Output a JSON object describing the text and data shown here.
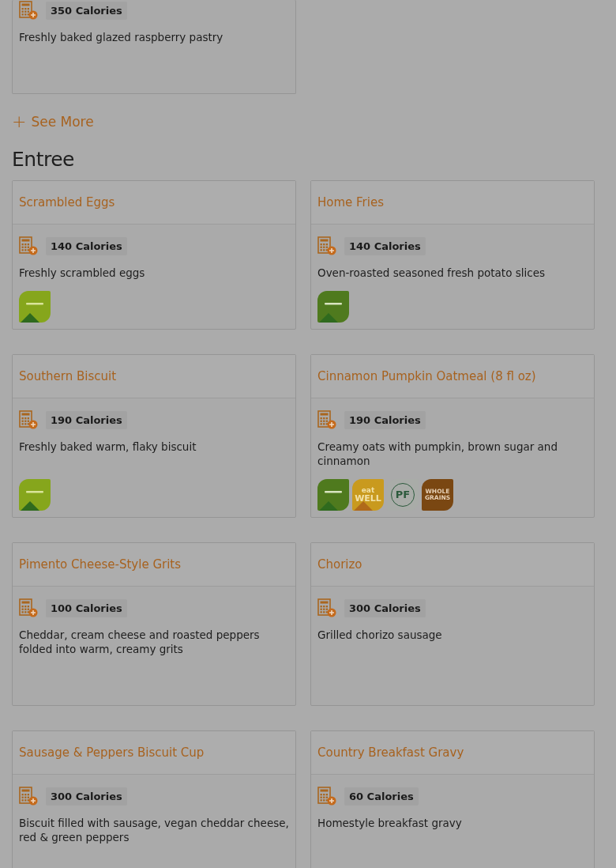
{
  "top_card": {
    "calories": "350 Calories",
    "description": "Freshly baked glazed raspberry pastry"
  },
  "see_more": {
    "icon": "+",
    "label": "See More"
  },
  "section": {
    "title": "Entree",
    "items": [
      {
        "name": "Scrambled Eggs",
        "calories": "140 Calories",
        "description": "Freshly scrambled eggs",
        "badges": [
          {
            "kind": "vegetarian"
          }
        ]
      },
      {
        "name": "Home Fries",
        "calories": "140 Calories",
        "description": "Oven-roasted seasoned fresh potato slices",
        "badges": [
          {
            "kind": "vegan"
          }
        ]
      },
      {
        "name": "Southern Biscuit",
        "calories": "190 Calories",
        "description": "Freshly baked warm, flaky biscuit",
        "badges": [
          {
            "kind": "vegetarian"
          }
        ]
      },
      {
        "name": "Cinnamon Pumpkin Oatmeal (8 fl oz)",
        "calories": "190 Calories",
        "description": "Creamy oats with pumpkin, brown sugar and cinnamon",
        "badges": [
          {
            "kind": "vegan"
          },
          {
            "kind": "eatwell",
            "lines": [
              "eat",
              "WELL"
            ]
          },
          {
            "kind": "plantforward",
            "lines": [
              "PF"
            ]
          },
          {
            "kind": "wholegrains",
            "lines": [
              "WHOLE",
              "GRAINS"
            ]
          }
        ]
      },
      {
        "name": "Pimento Cheese-Style Grits",
        "calories": "100 Calories",
        "description": "Cheddar, cream cheese and roasted peppers folded into warm, creamy grits"
      },
      {
        "name": "Chorizo",
        "calories": "300 Calories",
        "description": "Grilled chorizo sausage"
      },
      {
        "name": "Sausage & Peppers Biscuit Cup",
        "calories": "300 Calories",
        "description": "Biscuit filled with sausage, vegan cheddar cheese, red & green peppers"
      },
      {
        "name": "Country Breakfast Gravy",
        "calories": "60 Calories",
        "description": "Homestyle breakfast gravy"
      }
    ]
  }
}
